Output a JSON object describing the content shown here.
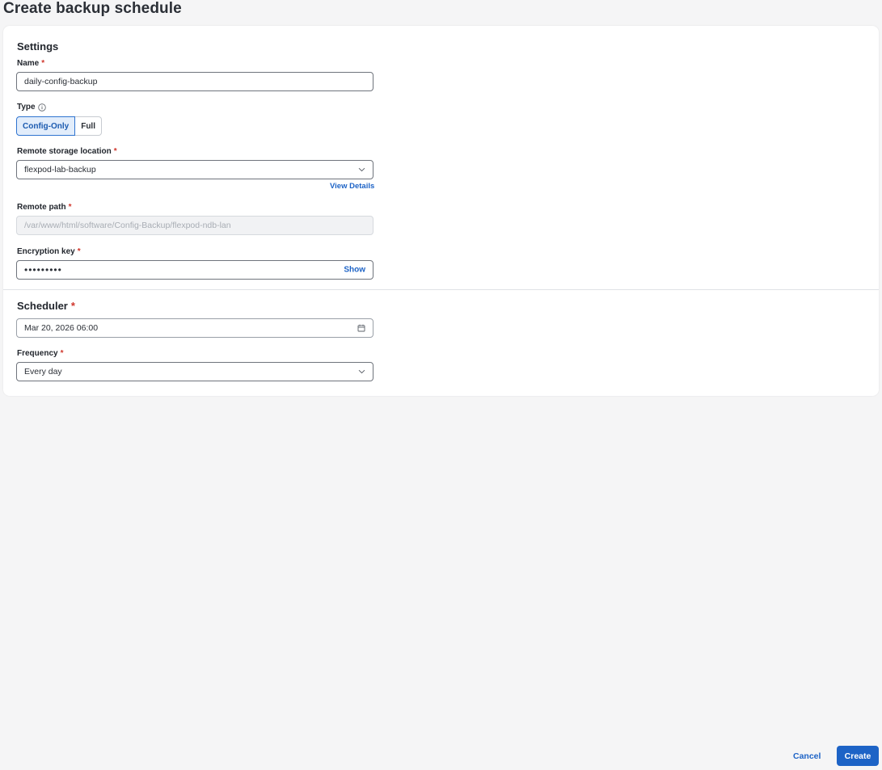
{
  "page": {
    "title": "Create backup schedule"
  },
  "settings": {
    "title": "Settings",
    "name": {
      "label": "Name",
      "required": "*",
      "value": "daily-config-backup"
    },
    "type": {
      "label": "Type",
      "options": [
        "Config-Only",
        "Full"
      ],
      "selected": "Config-Only"
    },
    "remote_storage": {
      "label": "Remote storage location",
      "required": "*",
      "value": "flexpod-lab-backup",
      "view_details": "View Details"
    },
    "remote_path": {
      "label": "Remote path",
      "required": "*",
      "placeholder": "/var/www/html/software/Config-Backup/flexpod-ndb-lan"
    },
    "encryption_key": {
      "label": "Encryption key",
      "required": "*",
      "masked_value": "•••••••••",
      "show_label": "Show"
    }
  },
  "scheduler": {
    "title": "Scheduler",
    "required": "*",
    "datetime": {
      "value": "Mar 20, 2026 06:00"
    },
    "frequency": {
      "label": "Frequency",
      "required": "*",
      "value": "Every day"
    }
  },
  "footer": {
    "cancel_label": "Cancel",
    "create_label": "Create"
  },
  "icons": {
    "info": "info-icon",
    "chevron": "chevron-down-icon",
    "calendar": "calendar-icon"
  },
  "colors": {
    "accent": "#1d63c6",
    "required": "#d0362c",
    "background": "#f5f5f6"
  }
}
